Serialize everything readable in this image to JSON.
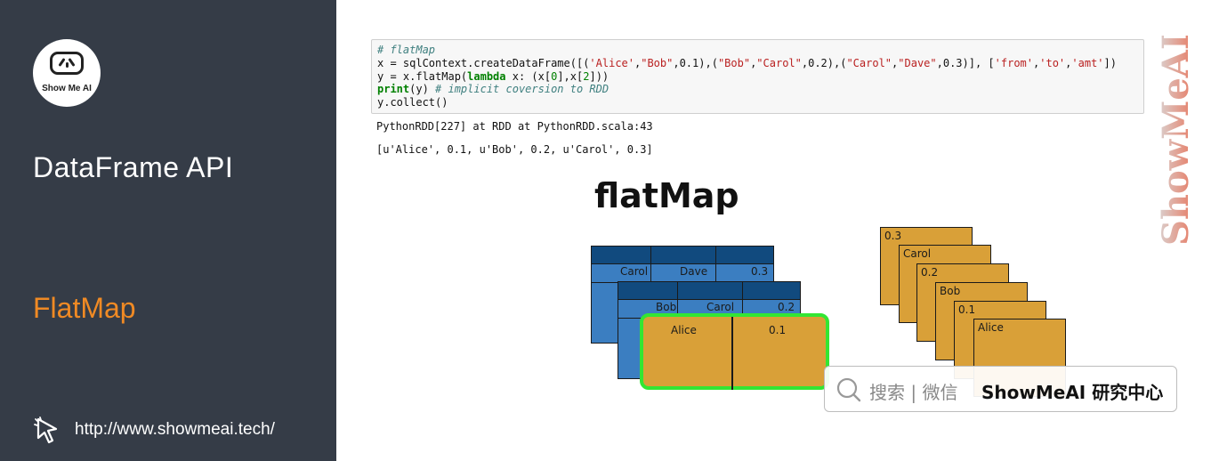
{
  "sidebar": {
    "logo_text": "Show Me AI",
    "title": "DataFrame API",
    "subtitle": "FlatMap",
    "url": "http://www.showmeai.tech/"
  },
  "code": {
    "line1_comment": "# flatMap",
    "line2": {
      "a": "x = sqlContext.createDataFrame([(",
      "s1": "'Alice'",
      "c1": ",",
      "s2": "\"Bob\"",
      "c2": ",0.1),(",
      "s3": "\"Bob\"",
      "c3": ",",
      "s4": "\"Carol\"",
      "c4": ",0.2),(",
      "s5": "\"Carol\"",
      "c5": ",",
      "s6": "\"Dave\"",
      "c6": ",0.3)], [",
      "s7": "'from'",
      "c7": ",",
      "s8": "'to'",
      "c8": ",",
      "s9": "'amt'",
      "c9": "])"
    },
    "line3": {
      "a": "y = x.flatMap(",
      "kw": "lambda",
      "b": " x: (x[",
      "n1": "0",
      "c": "],x[",
      "n2": "2",
      "d": "]))"
    },
    "line4": {
      "kw": "print",
      "a": "(y) ",
      "comment": "# implicit coversion to RDD"
    },
    "line5": "y.collect()"
  },
  "output": {
    "line1": "PythonRDD[227] at RDD at PythonRDD.scala:43",
    "line2": "[u'Alice', 0.1, u'Bob', 0.2, u'Carol', 0.3]"
  },
  "diagram": {
    "title": "flatMap",
    "back_row": [
      "Carol",
      "Dave",
      "0.3"
    ],
    "mid_row": [
      "Bob",
      "Carol",
      "0.2"
    ],
    "front_row": [
      "Alice",
      "0.1"
    ],
    "cards": [
      "0.3",
      "Carol",
      "0.2",
      "Bob",
      "0.1",
      "Alice"
    ]
  },
  "search": {
    "text": "搜索 | 微信",
    "brand": "ShowMeAI 研究中心"
  },
  "watermark": "ShowMeAI",
  "colors": {
    "sidebar_bg": "#353c47",
    "accent_orange": "#f08a24",
    "df_blue": "#3b7ec1",
    "df_header": "#114a7e",
    "row_gold": "#d9a038",
    "highlight_green": "#33e633"
  }
}
